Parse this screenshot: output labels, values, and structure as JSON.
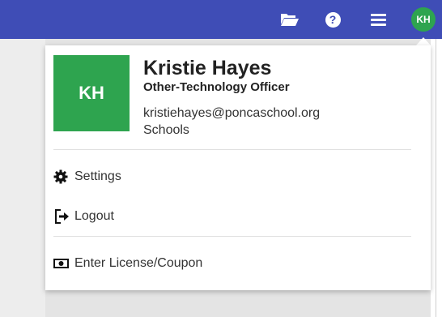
{
  "topbar": {
    "icons": [
      "folder-open-icon",
      "help-icon",
      "menu-icon"
    ],
    "avatar_initials": "KH",
    "color": "#3f4db6"
  },
  "profile": {
    "initials": "KH",
    "avatar_color": "#2ea44f",
    "name": "Kristie Hayes",
    "role": "Other-Technology Officer",
    "email": "kristiehayes@poncaschool.org",
    "organization": "Schools"
  },
  "menu": {
    "settings_label": "Settings",
    "logout_label": "Logout",
    "license_label": "Enter License/Coupon"
  }
}
